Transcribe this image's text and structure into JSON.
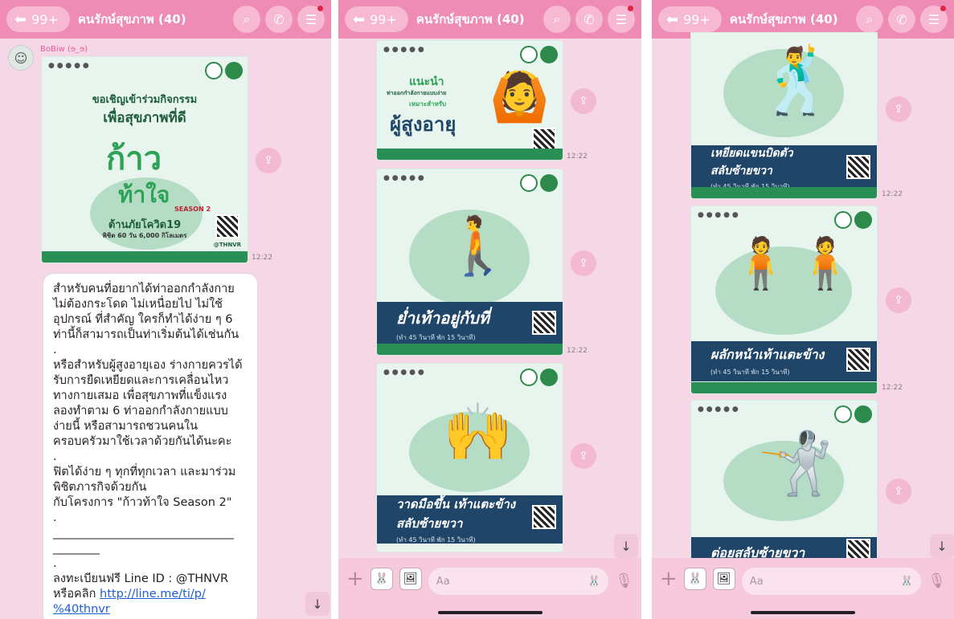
{
  "header": {
    "back_count": "99+",
    "title": "คนรักษ์สุขภาพ (40)"
  },
  "panel1": {
    "sender": "BoBiw (ɘ_ɘ)",
    "card": {
      "line1": "ขอเชิญเข้าร่วมกิจกรรม",
      "line2": "เพื่อสุขภาพที่ดี",
      "logo_a": "ก้าว",
      "logo_b": "ท้าใจ",
      "season": "SEASON 2",
      "line3": "ต้านภัยโควิด19",
      "line4": "พิชิต 60 วัน 6,000 กิโลเมตร",
      "tag": "@THNVR"
    },
    "time": "12:22",
    "message": "สำหรับคนที่อยากได้ท่าออกกำลังกาย\nไม่ต้องกระโดด ไม่เหนื่อยไป ไม่ใช้\nอุปกรณ์ ที่สำคัญ ใครก็ทำได้ง่าย ๆ 6\nท่านี้ก็สามารถเป็นท่าเริ่มต้นได้เช่นกัน\n.\nหรือสำหรับผู้สูงอายุเอง ร่างกายควรได้\nรับการยืดเหยียดและการเคลื่อนไหว\nทางกายเสมอ เพื่อสุขภาพที่แข็งแรง\nลองทำตาม 6 ท่าออกกำลังกายแบบ\nง่ายนี้ หรือสามารถชวนคนใน\nครอบครัวมาใช้เวลาด้วยกันได้นะคะ\n.\nฟิตได้ง่าย ๆ ทุกที่ทุกเวลา และมาร่วม\nพิชิตภารกิจด้วยกัน\nกับโครงการ \"ก้าวท้าใจ Season 2\"\n.\n_______________________________\n________\n.\nลงทะเบียนฟรี Line ID : @THNVR\nหรือคลิก ",
    "link": "http://line.me/ti/p/\n%40thnvr"
  },
  "panel2": {
    "card1": {
      "a": "แนะนำ",
      "b": "ท่าออกกำลังกายแบบง่าย",
      "c": "เหมาะสำหรับ",
      "d": "ผู้สูงอายุ",
      "time": "12:22"
    },
    "card2": {
      "big": "ย่ำเท้าอยู่กับที่",
      "small": "(ทำ 45 วินาที พัก 15 วินาที)",
      "time": "12:22"
    },
    "card3": {
      "big": "วาดมือขึ้น เท้าแตะข้าง",
      "big2": "สลับซ้ายขวา",
      "small": "(ทำ 45 วินาที พัก 15 วินาที)"
    }
  },
  "panel3": {
    "card1": {
      "big": "เหยียดแขนบิดตัว",
      "big2": "สลับซ้ายขวา",
      "small": "(ทำ 45 วินาที พัก 15 วินาที)",
      "time": "12:22"
    },
    "card2": {
      "big": "ผลักหน้าเท้าแตะข้าง",
      "small": "(ทำ 45 วินาที พัก 15 วินาที)",
      "time": "12:22"
    },
    "card3": {
      "big": "ต่อยสลับซ้ายขวา"
    }
  },
  "footer": {
    "placeholder": "Aa"
  },
  "icons": {
    "back": "arrow-left-icon",
    "search": "search-icon",
    "call": "phone-icon",
    "menu": "menu-icon",
    "share": "share-icon",
    "down": "arrow-down-icon"
  }
}
